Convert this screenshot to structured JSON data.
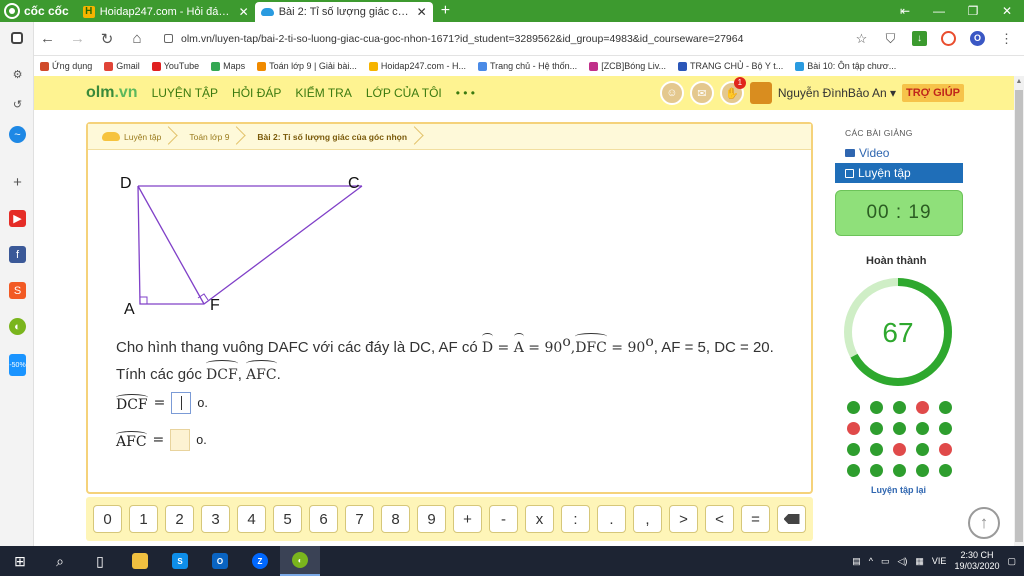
{
  "browser": {
    "brand": "cốc cốc",
    "tabs": [
      {
        "title": "Hoidap247.com - Hỏi đáp on",
        "close": "✕"
      },
      {
        "title": "Bài 2: Tỉ số lượng giác của gó",
        "close": "✕"
      }
    ],
    "new_tab": "+",
    "url": "olm.vn/luyen-tap/bai-2-ti-so-luong-giac-cua-goc-nhon-1671?id_student=3289562&id_group=4983&id_courseware=27964",
    "bookmarks": [
      {
        "label": "Ứng dụng",
        "color": "#d04a2a"
      },
      {
        "label": "Gmail",
        "color": "#e04437"
      },
      {
        "label": "YouTube",
        "color": "#e02020"
      },
      {
        "label": "Maps",
        "color": "#34a853"
      },
      {
        "label": "Toán lớp 9 | Giải bài...",
        "color": "#f08a00"
      },
      {
        "label": "Hoidap247.com - H...",
        "color": "#f6b400"
      },
      {
        "label": "Trang chủ - Hệ thốn...",
        "color": "#4a8ae6"
      },
      {
        "label": "[ZCB]Bóng Liv...",
        "color": "#c0308a"
      },
      {
        "label": "TRANG CHỦ - Bộ Y t...",
        "color": "#2b56b8"
      },
      {
        "label": "Bài 10: Ôn tập chươ...",
        "color": "#2a9be0"
      }
    ]
  },
  "site": {
    "logo_a": "olm",
    "logo_b": ".vn",
    "menu": [
      "LUYỆN TẬP",
      "HỎI ĐÁP",
      "KIỂM TRA",
      "LỚP CỦA TÔI",
      "• • •"
    ],
    "notif_count": "1",
    "user": "Nguyễn ĐìnhBảo An ▾",
    "help": "TRỢ GIÚP"
  },
  "breadcrumb": [
    "Luyện tập",
    "Toán lớp 9",
    "Bài 2: Tỉ số lượng giác của góc nhọn"
  ],
  "figure": {
    "labels": [
      "D",
      "C",
      "A",
      "F"
    ]
  },
  "question": {
    "text1": "Cho hình thang vuông DAFC với các đáy là DC, AF có ",
    "ang_D": "D",
    "eq1": " = ",
    "ang_A": "A",
    "eq2": " = 90",
    "deg": "o",
    "comma": ",",
    "ang_DFC": "DFC",
    "eq3": " = 90",
    "text2": ", AF = 5, DC = 20. Tính các góc ",
    "ang_DCF": "DCF",
    "sep": ", ",
    "ang_AFC": "AFC",
    "end": "."
  },
  "answers": [
    {
      "angle": "DCF",
      "eq": " = ",
      "unit": "o."
    },
    {
      "angle": "AFC",
      "eq": " = ",
      "unit": "o."
    }
  ],
  "keypad": [
    "0",
    "1",
    "2",
    "3",
    "4",
    "5",
    "6",
    "7",
    "8",
    "9",
    "+",
    "-",
    "x",
    ":",
    ".",
    ",",
    ">",
    "<",
    "="
  ],
  "side": {
    "section_title": "CÁC BÀI GIẢNG",
    "video": "Video",
    "practice": "Luyện tập",
    "timer": "00 : 19",
    "done_label": "Hoàn thành",
    "score": "67",
    "score_fraction": 0.67,
    "retry": "Luyện tập lại",
    "dots": [
      "#2e9e2e",
      "#2e9e2e",
      "#2e9e2e",
      "#e04a4a",
      "#2e9e2e",
      "#e04a4a",
      "#2e9e2e",
      "#2e9e2e",
      "#2e9e2e",
      "#2e9e2e",
      "#2e9e2e",
      "#2e9e2e",
      "#e04a4a",
      "#2e9e2e",
      "#e04a4a",
      "#2e9e2e",
      "#2e9e2e",
      "#2e9e2e",
      "#2e9e2e",
      "#2e9e2e"
    ]
  },
  "taskbar": {
    "lang": "VIE",
    "time": "2:30 CH",
    "date": "19/03/2020"
  }
}
